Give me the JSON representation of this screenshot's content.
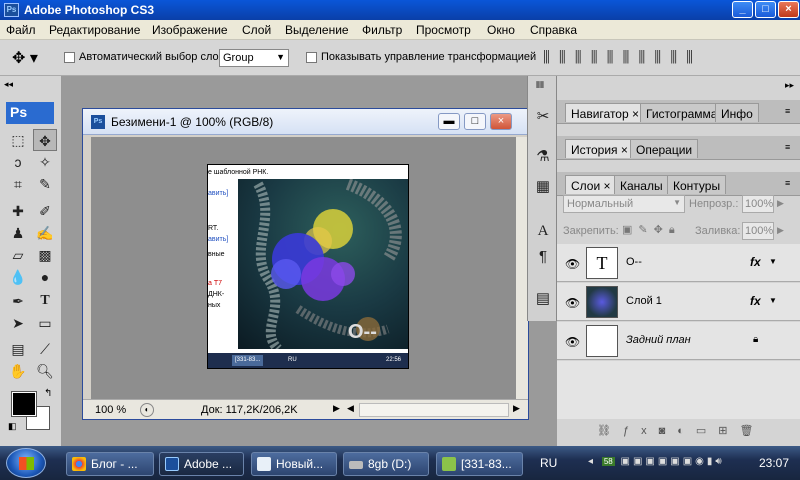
{
  "app": {
    "title": "Adobe Photoshop CS3"
  },
  "menu": [
    "Файл",
    "Редактирование",
    "Изображение",
    "Слой",
    "Выделение",
    "Фильтр",
    "Просмотр",
    "Окно",
    "Справка"
  ],
  "options": {
    "auto_select_label": "Автоматический выбор слоя",
    "auto_select_value": "Group",
    "transform_label": "Показывать управление трансформацией"
  },
  "toolbox": {
    "logo": "Ps"
  },
  "document": {
    "title": "Безимени-1 @ 100% (RGB/8)",
    "zoom": "100 %",
    "doc_info": "Док: 117,2K/206,2K",
    "inner_text": {
      "line1": "е шаблонной РНК.",
      "link1": "авить]",
      "line3": "RT.",
      "link2": "авить]",
      "line5": "вные",
      "red1": "а Т7",
      "line7": "ДНК-",
      "line8": "ных",
      "inner_os": "RU",
      "inner_clock": "22:56",
      "inner_task": "[331-83...",
      "inner_big": "O--"
    }
  },
  "panels": {
    "tabs_top": [
      "Навигатор",
      "Гистограмма",
      "Инфо"
    ],
    "tabs_mid": [
      "История",
      "Операции"
    ],
    "tabs_layers": [
      "Слои",
      "Каналы",
      "Контуры"
    ],
    "blend_mode": "Нормальный",
    "opacity_label": "Непрозр.:",
    "opacity": "100%",
    "lock_label": "Закрепить:",
    "fill_label": "Заливка:",
    "fill": "100%",
    "layers": [
      {
        "name": "O--",
        "type": "text"
      },
      {
        "name": "Слой 1",
        "type": "image"
      },
      {
        "name": "Задний план",
        "type": "background"
      }
    ]
  },
  "taskbar": {
    "buttons": [
      "Блог - ...",
      "Adobe ...",
      "Новый...",
      "8gb (D:)",
      "[331-83..."
    ],
    "lang": "RU",
    "clock": "23:07",
    "battery": "58"
  }
}
